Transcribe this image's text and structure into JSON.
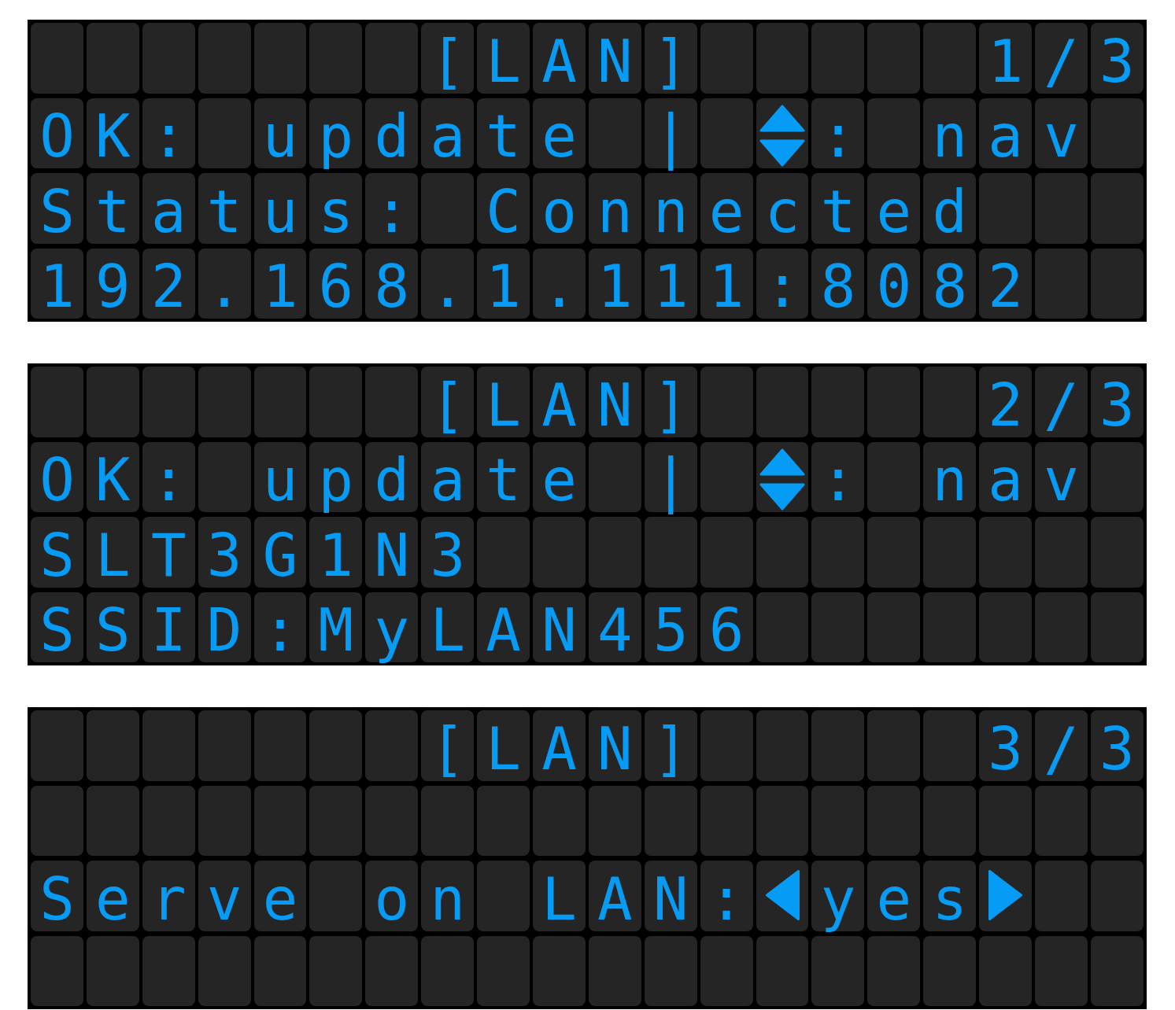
{
  "screens": [
    {
      "rows": [
        [
          null,
          null,
          null,
          null,
          null,
          null,
          null,
          {
            "kind": "char",
            "text": "["
          },
          {
            "kind": "char",
            "text": "L"
          },
          {
            "kind": "char",
            "text": "A"
          },
          {
            "kind": "char",
            "text": "N"
          },
          {
            "kind": "char",
            "text": "]"
          },
          null,
          null,
          null,
          null,
          null,
          {
            "kind": "char",
            "text": "1"
          },
          {
            "kind": "char",
            "text": "/"
          },
          {
            "kind": "char",
            "text": "3"
          }
        ],
        [
          {
            "kind": "char",
            "text": "O"
          },
          {
            "kind": "char",
            "text": "K"
          },
          {
            "kind": "char",
            "text": ":"
          },
          null,
          {
            "kind": "char",
            "text": "u"
          },
          {
            "kind": "char",
            "text": "p"
          },
          {
            "kind": "char",
            "text": "d"
          },
          {
            "kind": "char",
            "text": "a"
          },
          {
            "kind": "char",
            "text": "t"
          },
          {
            "kind": "char",
            "text": "e"
          },
          null,
          {
            "kind": "char",
            "text": "|"
          },
          null,
          {
            "kind": "updown"
          },
          {
            "kind": "char",
            "text": ":"
          },
          null,
          {
            "kind": "char",
            "text": "n"
          },
          {
            "kind": "char",
            "text": "a"
          },
          {
            "kind": "char",
            "text": "v"
          }
        ],
        [
          {
            "kind": "char",
            "text": "S"
          },
          {
            "kind": "char",
            "text": "t"
          },
          {
            "kind": "char",
            "text": "a"
          },
          {
            "kind": "char",
            "text": "t"
          },
          {
            "kind": "char",
            "text": "u"
          },
          {
            "kind": "char",
            "text": "s"
          },
          {
            "kind": "char",
            "text": ":"
          },
          null,
          {
            "kind": "char",
            "text": "C"
          },
          {
            "kind": "char",
            "text": "o"
          },
          {
            "kind": "char",
            "text": "n"
          },
          {
            "kind": "char",
            "text": "n"
          },
          {
            "kind": "char",
            "text": "e"
          },
          {
            "kind": "char",
            "text": "c"
          },
          {
            "kind": "char",
            "text": "t"
          },
          {
            "kind": "char",
            "text": "e"
          },
          {
            "kind": "char",
            "text": "d"
          }
        ],
        [
          {
            "kind": "char",
            "text": "1"
          },
          {
            "kind": "char",
            "text": "9"
          },
          {
            "kind": "char",
            "text": "2"
          },
          {
            "kind": "char",
            "text": "."
          },
          {
            "kind": "char",
            "text": "1"
          },
          {
            "kind": "char",
            "text": "6"
          },
          {
            "kind": "char",
            "text": "8"
          },
          {
            "kind": "char",
            "text": "."
          },
          {
            "kind": "char",
            "text": "1"
          },
          {
            "kind": "char",
            "text": "."
          },
          {
            "kind": "char",
            "text": "1"
          },
          {
            "kind": "char",
            "text": "1"
          },
          {
            "kind": "char",
            "text": "1"
          },
          {
            "kind": "char",
            "text": ":"
          },
          {
            "kind": "char",
            "text": "8"
          },
          {
            "kind": "char",
            "text": "0"
          },
          {
            "kind": "char",
            "text": "8"
          },
          {
            "kind": "char",
            "text": "2"
          }
        ]
      ]
    },
    {
      "rows": [
        [
          null,
          null,
          null,
          null,
          null,
          null,
          null,
          {
            "kind": "char",
            "text": "["
          },
          {
            "kind": "char",
            "text": "L"
          },
          {
            "kind": "char",
            "text": "A"
          },
          {
            "kind": "char",
            "text": "N"
          },
          {
            "kind": "char",
            "text": "]"
          },
          null,
          null,
          null,
          null,
          null,
          {
            "kind": "char",
            "text": "2"
          },
          {
            "kind": "char",
            "text": "/"
          },
          {
            "kind": "char",
            "text": "3"
          }
        ],
        [
          {
            "kind": "char",
            "text": "O"
          },
          {
            "kind": "char",
            "text": "K"
          },
          {
            "kind": "char",
            "text": ":"
          },
          null,
          {
            "kind": "char",
            "text": "u"
          },
          {
            "kind": "char",
            "text": "p"
          },
          {
            "kind": "char",
            "text": "d"
          },
          {
            "kind": "char",
            "text": "a"
          },
          {
            "kind": "char",
            "text": "t"
          },
          {
            "kind": "char",
            "text": "e"
          },
          null,
          {
            "kind": "char",
            "text": "|"
          },
          null,
          {
            "kind": "updown"
          },
          {
            "kind": "char",
            "text": ":"
          },
          null,
          {
            "kind": "char",
            "text": "n"
          },
          {
            "kind": "char",
            "text": "a"
          },
          {
            "kind": "char",
            "text": "v"
          }
        ],
        [
          {
            "kind": "char",
            "text": "S"
          },
          {
            "kind": "char",
            "text": "L"
          },
          {
            "kind": "char",
            "text": "T"
          },
          {
            "kind": "char",
            "text": "3"
          },
          {
            "kind": "char",
            "text": "G"
          },
          {
            "kind": "char",
            "text": "1"
          },
          {
            "kind": "char",
            "text": "N"
          },
          {
            "kind": "char",
            "text": "3"
          }
        ],
        [
          {
            "kind": "char",
            "text": "S"
          },
          {
            "kind": "char",
            "text": "S"
          },
          {
            "kind": "char",
            "text": "I"
          },
          {
            "kind": "char",
            "text": "D"
          },
          {
            "kind": "char",
            "text": ":"
          },
          {
            "kind": "char",
            "text": "M"
          },
          {
            "kind": "char",
            "text": "y"
          },
          {
            "kind": "char",
            "text": "L"
          },
          {
            "kind": "char",
            "text": "A"
          },
          {
            "kind": "char",
            "text": "N"
          },
          {
            "kind": "char",
            "text": "4"
          },
          {
            "kind": "char",
            "text": "5"
          },
          {
            "kind": "char",
            "text": "6"
          }
        ]
      ]
    },
    {
      "rows": [
        [
          null,
          null,
          null,
          null,
          null,
          null,
          null,
          {
            "kind": "char",
            "text": "["
          },
          {
            "kind": "char",
            "text": "L"
          },
          {
            "kind": "char",
            "text": "A"
          },
          {
            "kind": "char",
            "text": "N"
          },
          {
            "kind": "char",
            "text": "]"
          },
          null,
          null,
          null,
          null,
          null,
          {
            "kind": "char",
            "text": "3"
          },
          {
            "kind": "char",
            "text": "/"
          },
          {
            "kind": "char",
            "text": "3"
          }
        ],
        null,
        [
          {
            "kind": "char",
            "text": "S"
          },
          {
            "kind": "char",
            "text": "e"
          },
          {
            "kind": "char",
            "text": "r"
          },
          {
            "kind": "char",
            "text": "v"
          },
          {
            "kind": "char",
            "text": "e"
          },
          null,
          {
            "kind": "char",
            "text": "o"
          },
          {
            "kind": "char",
            "text": "n"
          },
          null,
          {
            "kind": "char",
            "text": "L"
          },
          {
            "kind": "char",
            "text": "A"
          },
          {
            "kind": "char",
            "text": "N"
          },
          {
            "kind": "char",
            "text": ":"
          },
          {
            "kind": "left"
          },
          {
            "kind": "char",
            "text": "y"
          },
          {
            "kind": "char",
            "text": "e"
          },
          {
            "kind": "char",
            "text": "s"
          },
          {
            "kind": "right"
          }
        ],
        null
      ]
    }
  ]
}
